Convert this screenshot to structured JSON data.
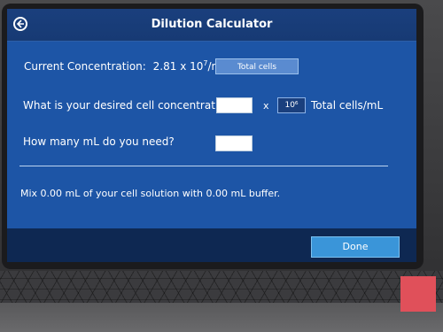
{
  "window": {
    "title": "Dilution Calculator"
  },
  "current": {
    "label": "Current Concentration:",
    "value": "2.81 x 10",
    "exponent": "7",
    "unit": "/mL"
  },
  "total_cells_button": "Total cells",
  "desired": {
    "label": "What is your desired cell concentration?",
    "input_value": "",
    "multiply": "x",
    "exponent_label": "10⁶",
    "unit": "Total cells/mL"
  },
  "volume": {
    "label": "How many mL do you need?",
    "input_value": ""
  },
  "result": {
    "text": "Mix 0.00 mL of your cell solution with 0.00 mL buffer."
  },
  "done_button": "Done",
  "colors": {
    "screen_bg": "#1d55a6",
    "title_bg": "#1a3f7d",
    "accent": "#3a95d9"
  }
}
